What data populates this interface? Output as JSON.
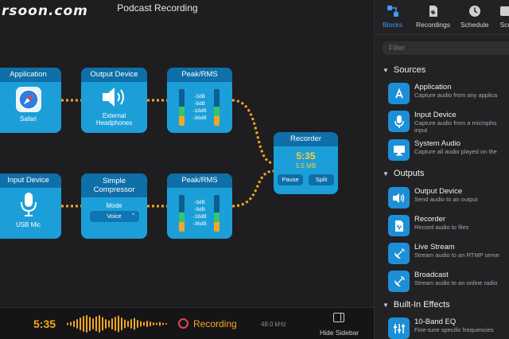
{
  "watermark": "rsoon.com",
  "window_title": "Podcast Recording",
  "blocks": {
    "application": {
      "title": "Application",
      "caption": "Safari",
      "icon": "safari-icon"
    },
    "output_device": {
      "title": "Output Device",
      "caption_line1": "External",
      "caption_line2": "Headphones",
      "icon": "speaker-icon"
    },
    "peak_top": {
      "title": "Peak/RMS",
      "levels": [
        "-3dB",
        "-9dB",
        "-18dB",
        "-36dB"
      ]
    },
    "input_device": {
      "title": "Input Device",
      "caption": "USB Mic",
      "icon": "microphone-icon"
    },
    "compressor": {
      "title_line1": "Simple",
      "title_line2": "Compressor",
      "mode_label": "Mode",
      "mode_value": "Voice"
    },
    "peak_bottom": {
      "title": "Peak/RMS",
      "levels": [
        "-3dB",
        "-9dB",
        "-18dB",
        "-36dB"
      ]
    },
    "recorder": {
      "title": "Recorder",
      "time": "5:35",
      "size": "5.5 MB",
      "pause_label": "Pause",
      "split_label": "Split"
    }
  },
  "bottom_bar": {
    "time": "5:35",
    "status": "Recording",
    "sample_rate": "48.0 kHz",
    "hide_sidebar": "Hide Sidebar"
  },
  "sidebar": {
    "tabs": [
      {
        "label": "Blocks",
        "icon": "blocks-icon",
        "active": true
      },
      {
        "label": "Recordings",
        "icon": "recordings-icon",
        "active": false
      },
      {
        "label": "Schedule",
        "icon": "clock-icon",
        "active": false
      },
      {
        "label": "Scr",
        "icon": "script-icon",
        "active": false
      }
    ],
    "filter_placeholder": "Filter",
    "sections": {
      "sources": "Sources",
      "outputs": "Outputs",
      "effects": "Built-In Effects"
    },
    "items": {
      "application": {
        "name": "Application",
        "desc": "Capture audio from any applica"
      },
      "input_device": {
        "name": "Input Device",
        "desc_line1": "Capture audio from a micropho",
        "desc_line2": "input"
      },
      "system_audio": {
        "name": "System Audio",
        "desc": "Capture all audio played on the"
      },
      "output_device": {
        "name": "Output Device",
        "desc": "Send audio to an output"
      },
      "recorder": {
        "name": "Recorder",
        "desc": "Record audio to files"
      },
      "live_stream": {
        "name": "Live Stream",
        "desc": "Stream audio to an RTMP serve"
      },
      "broadcast": {
        "name": "Broadcast",
        "desc": "Stream audio to an online radio"
      },
      "eq": {
        "name": "10-Band EQ",
        "desc": "Fine-tune specific frequencies"
      }
    }
  },
  "colors": {
    "block_body": "#1c9fd8",
    "block_header": "#0f6fa8",
    "wire": "#f5a623",
    "accent_blue": "#3b9cf5",
    "record_red": "#e5484d"
  }
}
